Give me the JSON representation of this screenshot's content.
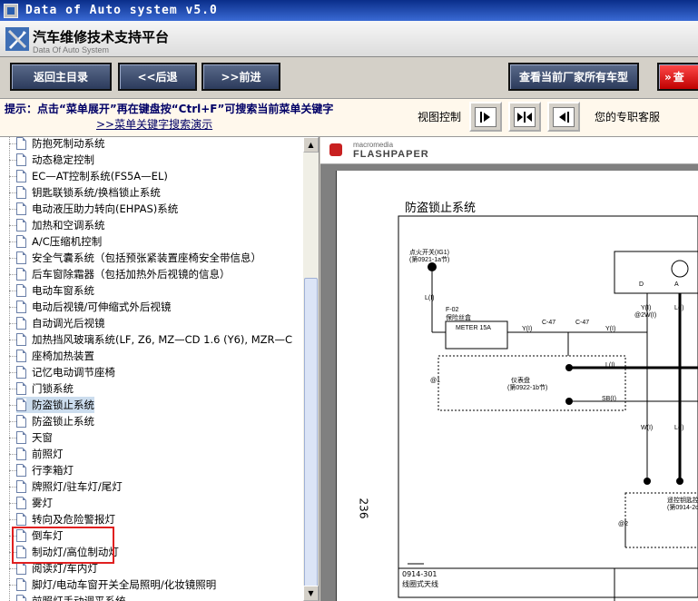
{
  "window": {
    "title": "Data of Auto system v5.0"
  },
  "header": {
    "title": "汽车维修技术支持平台",
    "subtitle": "Data Of Auto System"
  },
  "toolbar": {
    "home": "返回主目录",
    "back": "<<后退",
    "forward": ">>前进",
    "all_models": "查看当前厂家所有车型",
    "search": "查"
  },
  "tips": {
    "line1": "提示：点击“菜单展开”再在键盘按“Ctrl+F”可搜索当前菜单关键字",
    "line2": ">>菜单关键字搜索演示",
    "view_control": "视图控制",
    "service": "您的专职客服"
  },
  "tree": {
    "items": [
      "防抱死制动系统",
      "动态稳定控制",
      "EC—AT控制系统(FS5A—EL)",
      "钥匙联锁系统/换档锁止系统",
      "电动液压助力转向(EHPAS)系统",
      "加热和空调系统",
      "A/C压缩机控制",
      "安全气囊系统（包括预张紧装置座椅安全带信息）",
      "后车窗除霜器（包括加热外后视镜的信息）",
      "电动车窗系统",
      "电动后视镜/可伸缩式外后视镜",
      "自动调光后视镜",
      "加热挡风玻璃系统(LF, Z6, MZ—CD 1.6 (Y6), MZR—C",
      "座椅加热装置",
      "记忆电动调节座椅",
      "门锁系统",
      "防盗锁止系统",
      "防盗锁止系统",
      "天窗",
      "前照灯",
      "行李箱灯",
      "牌照灯/驻车灯/尾灯",
      "雾灯",
      "转向及危险警报灯",
      "倒车灯",
      "制动灯/高位制动灯",
      "阅读灯/车内灯",
      "脚灯/电动车窗开关全局照明/化妆镜照明",
      "前照灯手动调平系统"
    ]
  },
  "viewer": {
    "brand_top": "macromedia",
    "brand": "FLASHPAPER",
    "doc_title": "防盗锁止系统",
    "page_number": "236",
    "labels": {
      "ignition": "点火开关(IG1)",
      "ignition_ref": "(第0921-1a节)",
      "fuse_id": "F-02",
      "fuse_name": "保险丝盒",
      "meter": "METER 15A",
      "c47a": "C-47",
      "c47b": "C-47",
      "panel": "仪表盘",
      "panel_ref": "(第0922-1b节)",
      "l1": "L(I)",
      "l2": "L(I)",
      "l3": "L(I)",
      "l4": "L(I)",
      "y1": "Y(I)",
      "y2": "Y(I)",
      "y3": "Y(I)",
      "y2w": "@2W(I)",
      "sb": "SB(I)",
      "w": "W(I)",
      "d": "D",
      "a": "A",
      "at1": "@1",
      "at2": "@2",
      "immob": "遥控钥匙控制",
      "immob_ref": "(第0914-2c节",
      "footer_code": "0914-301",
      "footer_text": "线圈式天线"
    }
  }
}
